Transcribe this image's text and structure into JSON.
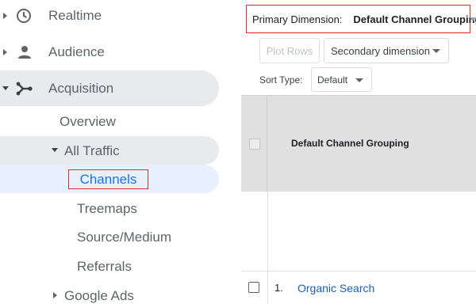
{
  "sidebar": {
    "items": [
      {
        "label": "Realtime",
        "icon": "clock-icon"
      },
      {
        "label": "Audience",
        "icon": "person-icon"
      },
      {
        "label": "Acquisition",
        "icon": "acquisition-icon"
      },
      {
        "label": "Overview"
      },
      {
        "label": "All Traffic"
      },
      {
        "label": "Channels",
        "selected": true
      },
      {
        "label": "Treemaps"
      },
      {
        "label": "Source/Medium"
      },
      {
        "label": "Referrals"
      },
      {
        "label": "Google Ads"
      }
    ]
  },
  "main": {
    "primary_dimension_label": "Primary Dimension:",
    "primary_dimension_value": "Default Channel Grouping",
    "plot_rows_label": "Plot Rows",
    "secondary_dimension_label": "Secondary dimension",
    "sort_type_label": "Sort Type:",
    "sort_type_value": "Default",
    "table": {
      "header_dimension": "Default Channel Grouping",
      "rows": [
        {
          "number": "1.",
          "channel": "Organic Search"
        }
      ]
    }
  },
  "colors": {
    "highlight_border": "#d93025",
    "link_blue": "#1a73e8",
    "active_nav_bg": "#e8f0fe",
    "group_nav_bg": "#e8eaed",
    "table_header_bg": "#e0e0e0"
  }
}
